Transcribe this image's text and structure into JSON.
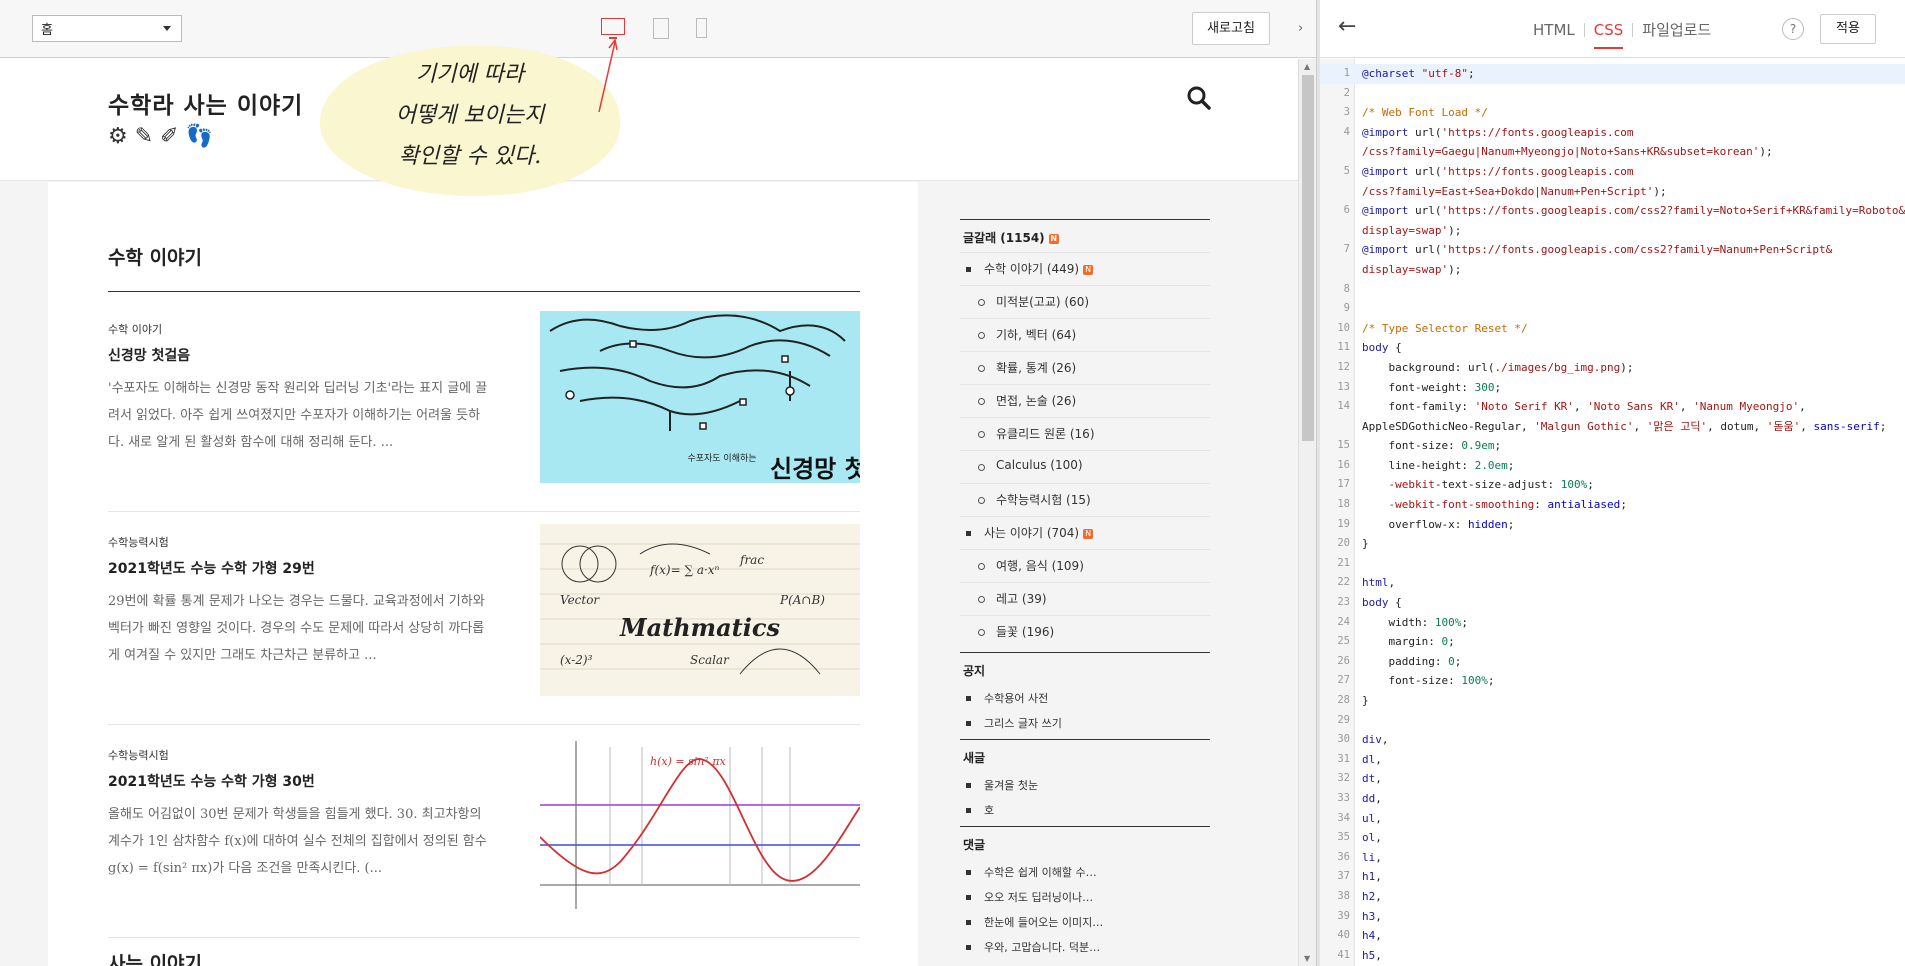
{
  "toolbar": {
    "page_select": "홈",
    "refresh_label": "새로고침",
    "collapse_arrow": "›"
  },
  "blog": {
    "title": "수학라 사는 이야기",
    "section_title": "수학 이야기",
    "next_section_title": "사는 이야기",
    "posts": [
      {
        "category": "수학 이야기",
        "title": "신경망 첫걸음",
        "excerpt": "'수포자도 이해하는 신경망 동작 원리와 딥러닝 기초'라는 표지 글에 끌려서 읽었다. 아주 쉽게 쓰여졌지만 수포자가 이해하기는 어려울 듯하다. 새로 알게 된 활성화 함수에 대해 정리해 둔다. ...",
        "thumb_text": "신경망 첫걸음"
      },
      {
        "category": "수학능력시험",
        "title": "2021학년도 수능 수학 가형 29번",
        "excerpt": "29번에 확률 통계 문제가 나오는 경우는 드물다. 교육과정에서 기하와 벡터가 빠진 영향일 것이다. 경우의 수도 문제에 따라서 상당히 까다롭게 여겨질 수 있지만 그래도 차근차근 분류하고 ...",
        "thumb_text": "Mathmatics"
      },
      {
        "category": "수학능력시험",
        "title": "2021학년도 수능 수학 가형 30번",
        "excerpt": "올해도 어김없이 30번 문제가 학생들을 힘들게 했다. 30. 최고차항의 계수가 1인 삼차함수 f(x)에 대하여 실수 전체의 집합에서 정의된 함수 g(x) = f(sin² πx)가 다음 조건을 만족시킨다. (...",
        "thumb_text": "h(x) = sin² πx"
      }
    ]
  },
  "sidebar": {
    "categories_head": "글갈래 (1154)",
    "categories": [
      {
        "label": "수학 이야기 (449)",
        "level": 1,
        "new": true
      },
      {
        "label": "미적분(고교) (60)",
        "level": 2
      },
      {
        "label": "기하, 벡터 (64)",
        "level": 2
      },
      {
        "label": "확률, 통계 (26)",
        "level": 2
      },
      {
        "label": "면접, 논술 (26)",
        "level": 2
      },
      {
        "label": "유클리드 원론 (16)",
        "level": 2
      },
      {
        "label": "Calculus (100)",
        "level": 2
      },
      {
        "label": "수학능력시험 (15)",
        "level": 2
      },
      {
        "label": "사는 이야기 (704)",
        "level": 1,
        "new": true
      },
      {
        "label": "여행, 음식 (109)",
        "level": 2
      },
      {
        "label": "레고 (39)",
        "level": 2
      },
      {
        "label": "들꽃 (196)",
        "level": 2
      }
    ],
    "notice_head": "공지",
    "notices": [
      "수학용어 사전",
      "그리스 글자 쓰기"
    ],
    "recent_head": "새글",
    "recent": [
      "울겨을 첫눈",
      "호"
    ],
    "comments_head": "댓글",
    "comments": [
      "수학은 쉽게 이해할 수…",
      "오오 저도 딥러닝이나…",
      "한눈에 들어오는 이미지…",
      "우와, 고맙습니다. 덕분…"
    ]
  },
  "note": {
    "lines": [
      "기기에 따라",
      "어떻게 보이는지",
      "확인할 수 있다."
    ]
  },
  "editor": {
    "back_icon": "←",
    "tabs": [
      "HTML",
      "CSS",
      "파일업로드"
    ],
    "active_tab": "CSS",
    "help_label": "?",
    "apply_label": "적용",
    "colors": {
      "accent": "#e53935",
      "new_badge": "#ef6c2f"
    }
  }
}
